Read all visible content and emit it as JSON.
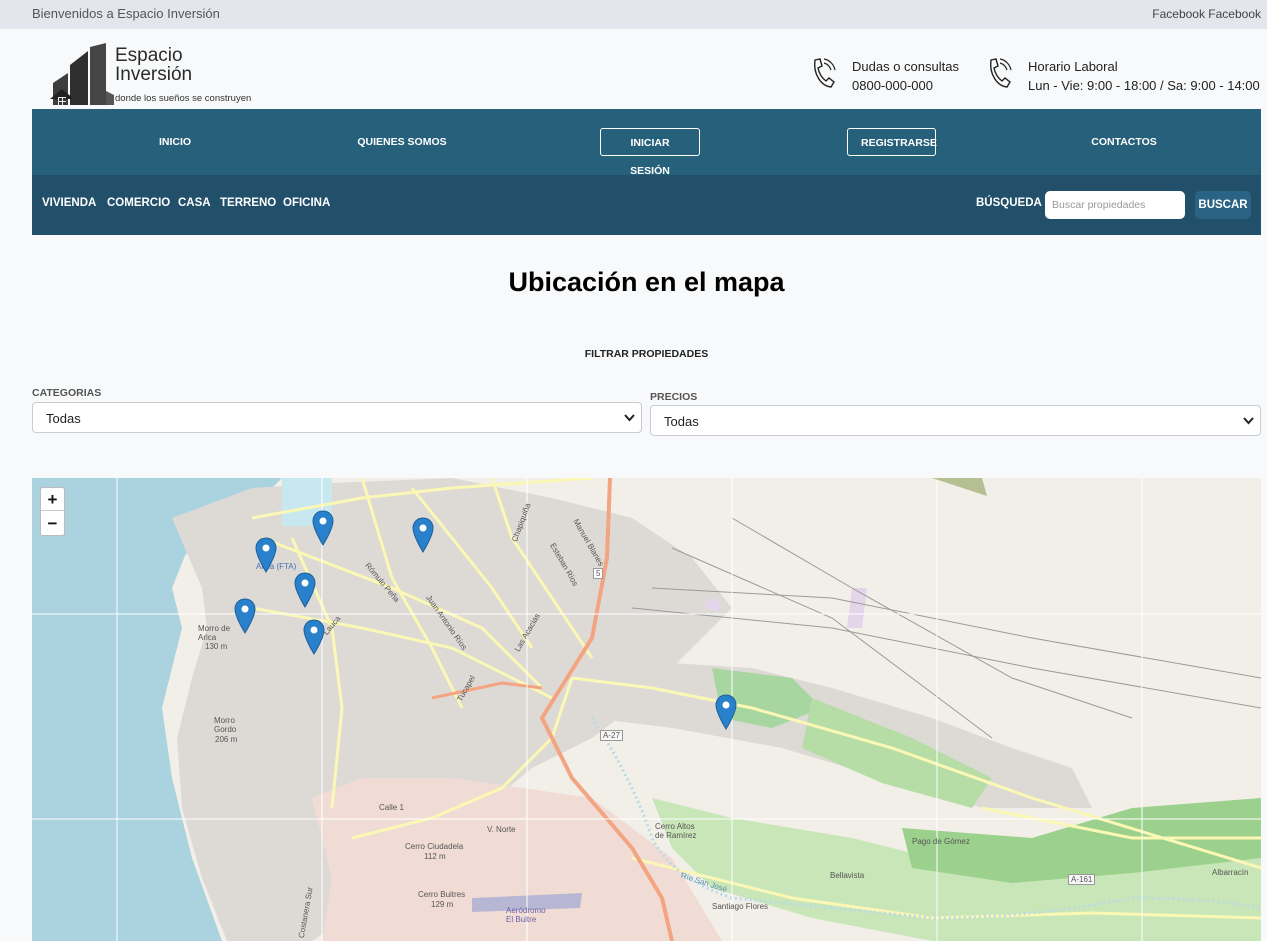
{
  "topbar": {
    "welcome": "Bienvenidos a Espacio Inversión",
    "social": "Facebook Facebook"
  },
  "brand": {
    "name_line1": "Espacio",
    "name_line2": "Inversión",
    "tagline": "donde los sueños se construyen",
    "logo_icon": "building-house-logo"
  },
  "contact": {
    "phone_label": "Dudas o consultas",
    "phone_number": "0800-000-000",
    "hours_label": "Horario Laboral",
    "hours_value": "Lun - Vie: 9:00 - 18:00 / Sa: 9:00 - 14:00",
    "icon": "phone-icon"
  },
  "nav": {
    "items": [
      "INICIO",
      "QUIENES SOMOS",
      "INICIAR SESIÓN",
      "REGISTRARSE",
      "CONTACTOS"
    ]
  },
  "categories_nav": {
    "items": [
      "VIVIENDA",
      "COMERCIO",
      "CASA",
      "TERRENO",
      "OFICINA"
    ],
    "search_label": "BÚSQUEDA",
    "search_placeholder": "Buscar propiedades",
    "search_button": "BUSCAR"
  },
  "main": {
    "title": "Ubicación en el mapa",
    "filter_title": "FILTRAR PROPIEDADES",
    "category_label": "CATEGORIAS",
    "category_value": "Todas",
    "price_label": "PRECIOS",
    "price_value": "Todas"
  },
  "map": {
    "zoom_in": "+",
    "zoom_out": "−",
    "marker_count": 7,
    "labels": [
      "Arica (FTA)",
      "Morro de Arica",
      "130 m",
      "Morro Gordo",
      "206 m",
      "Cerro Ciudadela",
      "112 m",
      "Cerro Buitres",
      "129 m",
      "Aeródromo El Buitre",
      "Cerro Altos de Ramírez",
      "Pago de Gómez",
      "Bellavista",
      "Albarracín",
      "A-27",
      "A-161",
      "5",
      "Santiago Flores",
      "Río San José",
      "V. Norte",
      "Calle 1",
      "Costanera Sur",
      "Lauca",
      "Tucapel",
      "Chapiquiña",
      "Esteban Ríos",
      "Manuel Blanes",
      "Rómulo Peña",
      "Juan Antonio Ríos",
      "Las Acacias"
    ],
    "colors": {
      "water": "#aad3df",
      "park": "#a8dca0",
      "road_major": "#f3a481",
      "road_yellow": "#f7f3a6",
      "urban": "#dfdcd8",
      "marker": "#2a81cb"
    }
  }
}
